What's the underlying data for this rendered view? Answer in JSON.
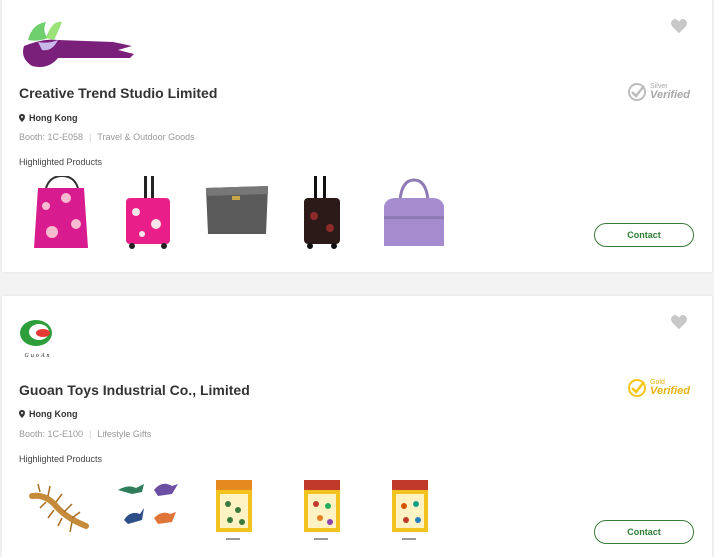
{
  "exhibitors": [
    {
      "name": "Creative Trend Studio Limited",
      "location": "Hong Kong",
      "booth": "Booth: 1C-E058",
      "category": "Travel & Outdoor Goods",
      "highlighted_label": "Highlighted Products",
      "badge": {
        "top": "Silver",
        "bottom": "Verified"
      },
      "contact_label": "Contact",
      "products": [
        "pink-floral-tote-bag",
        "pink-floral-rolling-bag",
        "grey-leather-laptop-case",
        "dark-floral-trolley-case",
        "purple-duffel-bag"
      ]
    },
    {
      "name": "Guoan Toys Industrial Co., Limited",
      "location": "Hong Kong",
      "booth": "Booth: 1C-E100",
      "category": "Lifestyle Gifts",
      "highlighted_label": "Highlighted Products",
      "badge": {
        "top": "Gold",
        "bottom": "Verified"
      },
      "contact_label": "Contact",
      "logo_text": "GuoAn",
      "products": [
        "centipede-toy",
        "dinosaur-figures-set",
        "carded-dinosaur-toys-1",
        "carded-dinosaur-toys-2",
        "carded-dinosaur-toys-3"
      ]
    }
  ],
  "colors": {
    "accent_green": "#2e7d32",
    "silver": "#a8a8a8",
    "gold": "#e7b10e",
    "heart": "#c8c8c8"
  }
}
